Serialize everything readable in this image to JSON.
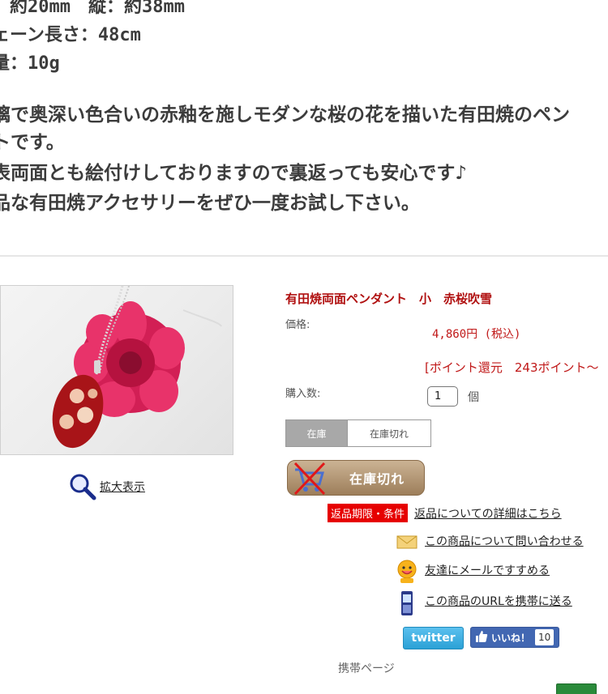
{
  "description": {
    "size_line": "：約20mm　縦：約38mm",
    "chain_line": "ェーン長さ：48cm",
    "weight_line": "量：10g",
    "text_lines": [
      "璃で奥深い色合いの赤釉を施しモダンな桜の花を描いた有田焼のペン",
      "トです。",
      "表両面とも絵付けしておりますので裏返っても安心です♪",
      "品な有田焼アクセサリーをぜひ一度お試し下さい。"
    ]
  },
  "product": {
    "zoom_label": "拡大表示",
    "title": "有田焼両面ペンダント　小　赤桜吹雪",
    "price_label": "価格:",
    "price_value": "4,860円 (税込)",
    "points": "[ポイント還元　243ポイント～",
    "qty_label": "購入数:",
    "qty_value": "1",
    "qty_unit": "個",
    "stock_tabs": [
      "在庫",
      "在庫切れ"
    ],
    "soldout_label": "在庫切れ"
  },
  "links": {
    "return_badge": "返品期限・条件",
    "return_link": "返品についての詳細はこちら",
    "inquiry_link": "この商品について問い合わせる",
    "friend_link": "友達にメールですすめる",
    "mobile_link": "この商品のURLを携帯に送る"
  },
  "social": {
    "twitter_label": "twitter",
    "like_label": "いいね！",
    "like_count": "10"
  },
  "footer": {
    "mobile_page": "携帯ページ"
  },
  "colors": {
    "accent_red": "#c01818",
    "title_red": "#b01010",
    "badge_red": "#e60000",
    "facebook_blue": "#4267b2",
    "twitter_blue": "#2ba1d6"
  },
  "icons": [
    "magnifier-icon",
    "cart-crossed-icon",
    "envelope-icon",
    "smiley-icon",
    "mobile-phone-icon",
    "thumbs-up-icon"
  ]
}
